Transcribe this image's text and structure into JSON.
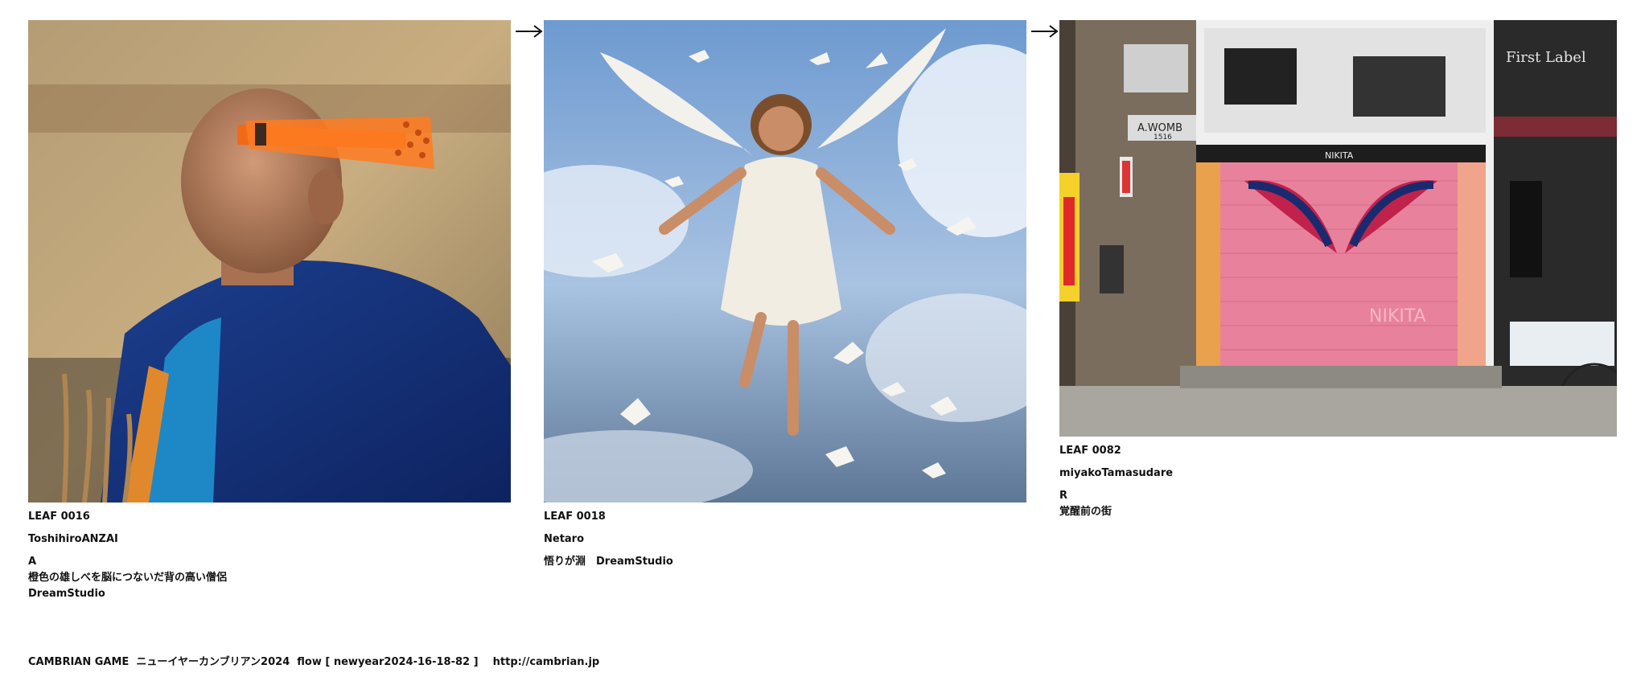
{
  "leaves": [
    {
      "code": "LEAF 0016",
      "author": "ToshihiroANZAI",
      "mark": "A",
      "description": "橙色の雄しべを脳につないだ背の高い僧侶",
      "tool": "DreamStudio"
    },
    {
      "code": "LEAF 0018",
      "author": "Netaro",
      "caption": "悟りが淵　DreamStudio"
    },
    {
      "code": "LEAF 0082",
      "author": "miyakoTamasudare",
      "mark": "R",
      "description": "覚醒前の街"
    }
  ],
  "arrows": [
    "arrow-right-icon",
    "arrow-right-icon"
  ],
  "footer": {
    "text": "CAMBRIAN GAME  ニューイヤーカンブリアン2024  flow [ newyear2024-16-18-82 ]    http://cambrian.jp"
  },
  "photo_signage": {
    "shop_left": "A.WOMB",
    "shop_left_sub": "1516",
    "shutter_top": "NIKITA",
    "shutter_text": "NIKITA",
    "shop_right": "First Label"
  }
}
